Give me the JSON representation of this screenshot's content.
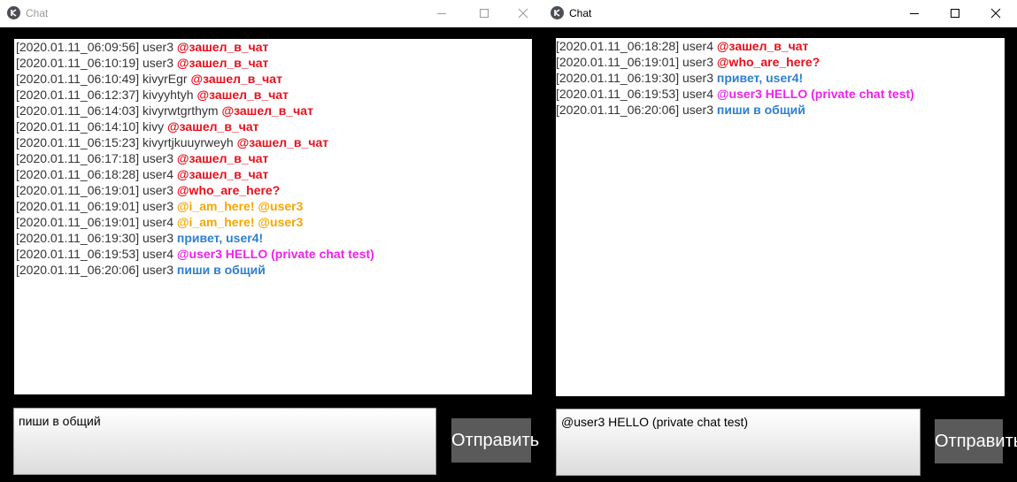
{
  "colors": {
    "join": "#e8101a",
    "question": "#e8101a",
    "answer": "#f5a700",
    "normal": "#2e7fcf",
    "private": "#ee22ee",
    "meta": "#333333"
  },
  "left": {
    "title": "Chat",
    "title_icon": "kivy-logo-icon",
    "messages": [
      {
        "ts": "[2020.01.11_06:09:56]",
        "user": "user3",
        "text": "@зашел_в_чат",
        "kind": "join"
      },
      {
        "ts": "[2020.01.11_06:10:19]",
        "user": "user3",
        "text": "@зашел_в_чат",
        "kind": "join"
      },
      {
        "ts": "[2020.01.11_06:10:49]",
        "user": "kivyrEgr",
        "text": "@зашел_в_чат",
        "kind": "join"
      },
      {
        "ts": "[2020.01.11_06:12:37]",
        "user": "kivyyhtyh",
        "text": "@зашел_в_чат",
        "kind": "join"
      },
      {
        "ts": "[2020.01.11_06:14:03]",
        "user": "kivyrwtgrthym",
        "text": "@зашел_в_чат",
        "kind": "join"
      },
      {
        "ts": "[2020.01.11_06:14:10]",
        "user": "kivy",
        "text": "@зашел_в_чат",
        "kind": "join"
      },
      {
        "ts": "[2020.01.11_06:15:23]",
        "user": "kivyrtjkuuyrweyh",
        "text": "@зашел_в_чат",
        "kind": "join"
      },
      {
        "ts": "[2020.01.11_06:17:18]",
        "user": "user3",
        "text": "@зашел_в_чат",
        "kind": "join"
      },
      {
        "ts": "[2020.01.11_06:18:28]",
        "user": "user4",
        "text": "@зашел_в_чат",
        "kind": "join"
      },
      {
        "ts": "[2020.01.11_06:19:01]",
        "user": "user3",
        "text": "@who_are_here?",
        "kind": "question"
      },
      {
        "ts": "[2020.01.11_06:19:01]",
        "user": "user3",
        "text": "@i_am_here! @user3",
        "kind": "answer"
      },
      {
        "ts": "[2020.01.11_06:19:01]",
        "user": "user4",
        "text": "@i_am_here! @user3",
        "kind": "answer"
      },
      {
        "ts": "[2020.01.11_06:19:30]",
        "user": "user3",
        "text": "привет, user4!",
        "kind": "normal"
      },
      {
        "ts": "[2020.01.11_06:19:53]",
        "user": "user4",
        "text": "@user3 HELLO (private chat test)",
        "kind": "private"
      },
      {
        "ts": "[2020.01.11_06:20:06]",
        "user": "user3",
        "text": "пиши в общий",
        "kind": "normal"
      }
    ],
    "input_value": "пиши в общий",
    "send_label": "Отправить"
  },
  "right": {
    "title": "Chat",
    "title_icon": "kivy-logo-icon",
    "messages": [
      {
        "ts": "[2020.01.11_06:18:28]",
        "user": "user4",
        "text": "@зашел_в_чат",
        "kind": "join"
      },
      {
        "ts": "[2020.01.11_06:19:01]",
        "user": "user3",
        "text": "@who_are_here?",
        "kind": "question"
      },
      {
        "ts": "[2020.01.11_06:19:30]",
        "user": "user3",
        "text": "привет, user4!",
        "kind": "normal"
      },
      {
        "ts": "[2020.01.11_06:19:53]",
        "user": "user4",
        "text": "@user3 HELLO (private chat test)",
        "kind": "private"
      },
      {
        "ts": "[2020.01.11_06:20:06]",
        "user": "user3",
        "text": "пиши в общий",
        "kind": "normal"
      }
    ],
    "input_value": "@user3 HELLO (private chat test)",
    "send_label": "Отправить"
  },
  "window_controls": [
    "minimize-icon",
    "maximize-icon",
    "close-icon"
  ]
}
